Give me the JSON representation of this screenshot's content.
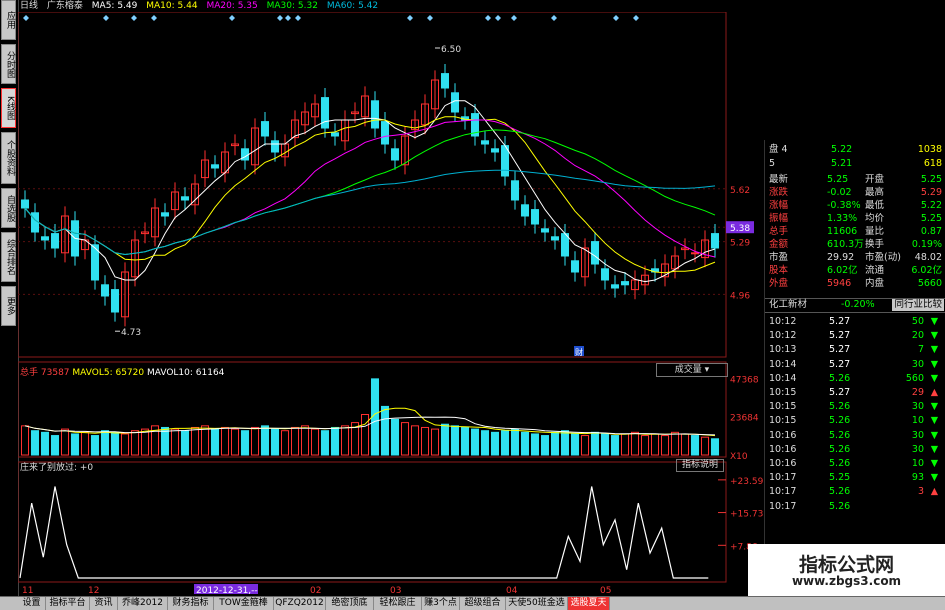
{
  "left_tabs": [
    "应用",
    "分时图",
    "K线图",
    "个股资料",
    "自选股",
    "综合排名",
    "更多"
  ],
  "header": {
    "period": "日线",
    "stock": "广东榕泰",
    "ma5": "MA5: 5.49",
    "ma10": "MA10: 5.44",
    "ma20": "MA20: 5.35",
    "ma30": "MA30: 5.32",
    "ma60": "MA60: 5.42"
  },
  "colors": {
    "ma5": "#ffffff",
    "ma10": "#ffff00",
    "ma20": "#ff00ff",
    "ma30": "#00ff00",
    "ma60": "#00b0d0",
    "up": "#ff3030",
    "down": "#30e0f0"
  },
  "price_chart": {
    "high_label": "6.50",
    "low_label": "4.73",
    "price_ticks": [
      "5.62",
      "5.38",
      "5.29",
      "4.96"
    ],
    "current_price": "5.38",
    "marker": "财"
  },
  "volume_panel": {
    "label": "总手",
    "total": "73587",
    "mavol5": "MAVOL5: 65720",
    "mavol10": "MAVOL10: 61164",
    "dropdown": "成交量",
    "ticks": [
      "47368",
      "23684",
      "X10"
    ]
  },
  "indicator_panel": {
    "title": "庄来了别放过: +0",
    "help": "指标说明",
    "ticks": [
      "+23.59",
      "+15.73",
      "+7.86"
    ]
  },
  "x_axis": {
    "labels": [
      "11",
      "12",
      "2012-12-31,--",
      "02",
      "03",
      "04",
      "05"
    ]
  },
  "quote": {
    "bids": [
      {
        "label": "盘 4",
        "price": "5.22",
        "vol": "1038"
      },
      {
        "label": "5",
        "price": "5.21",
        "vol": "618"
      }
    ],
    "rows": [
      {
        "l1": "最新",
        "v1": "5.25",
        "l2": "开盘",
        "v2": "5.25"
      },
      {
        "l1": "涨跌",
        "v1": "-0.02",
        "l2": "最高",
        "v2": "5.29"
      },
      {
        "l1": "涨幅",
        "v1": "-0.38%",
        "l2": "最低",
        "v2": "5.22"
      },
      {
        "l1": "振幅",
        "v1": "1.33%",
        "l2": "均价",
        "v2": "5.25"
      },
      {
        "l1": "总手",
        "v1": "11606",
        "l2": "量比",
        "v2": "0.87"
      },
      {
        "l1": "金额",
        "v1": "610.3万",
        "l2": "换手",
        "v2": "0.19%"
      },
      {
        "l1": "市盈",
        "v1": "29.92",
        "l2": "市盈(动)",
        "v2": "48.02"
      },
      {
        "l1": "股本",
        "v1": "6.02亿",
        "l2": "流通",
        "v2": "6.02亿"
      },
      {
        "l1": "外盘",
        "v1": "5946",
        "l2": "内盘",
        "v2": "5660"
      }
    ],
    "sector": "化工新材",
    "sector_change": "-0.20%",
    "compare_btn": "同行业比较",
    "ticks": [
      {
        "t": "10:12",
        "p": "5.27",
        "v": "50",
        "d": "down"
      },
      {
        "t": "10:12",
        "p": "5.27",
        "v": "20",
        "d": "down"
      },
      {
        "t": "10:13",
        "p": "5.27",
        "v": "7",
        "d": "down"
      },
      {
        "t": "10:14",
        "p": "5.27",
        "v": "30",
        "d": "down"
      },
      {
        "t": "10:14",
        "p": "5.26",
        "v": "560",
        "d": "down"
      },
      {
        "t": "10:15",
        "p": "5.27",
        "v": "29",
        "d": "up"
      },
      {
        "t": "10:15",
        "p": "5.26",
        "v": "30",
        "d": "down"
      },
      {
        "t": "10:15",
        "p": "5.26",
        "v": "10",
        "d": "down"
      },
      {
        "t": "10:16",
        "p": "5.26",
        "v": "30",
        "d": "down"
      },
      {
        "t": "10:16",
        "p": "5.26",
        "v": "30",
        "d": "down"
      },
      {
        "t": "10:16",
        "p": "5.26",
        "v": "10",
        "d": "down"
      },
      {
        "t": "10:17",
        "p": "5.25",
        "v": "93",
        "d": "down"
      },
      {
        "t": "10:17",
        "p": "5.26",
        "v": "3",
        "d": "up"
      },
      {
        "t": "10:17",
        "p": "5.26",
        "v": "",
        "d": ""
      }
    ]
  },
  "bottom_tabs": [
    "设置",
    "指标平台",
    "资讯",
    "乔峰2012",
    "财务指标",
    "TOW金箍棒",
    "QFZQ2012",
    "绝密顶底",
    "轻松跟庄",
    "赚3个点",
    "超级组合",
    "天使50班金选",
    "选股夏天"
  ],
  "watermark": {
    "title": "指标公式网",
    "url": "www.zbgs3.com"
  },
  "chart_data": {
    "type": "candlestick",
    "x_labels": [
      "11",
      "12",
      "2012-12-31,--",
      "02",
      "03",
      "04",
      "05"
    ],
    "price_range": [
      4.73,
      6.5
    ],
    "ylim": [
      4.6,
      6.6
    ],
    "close": [
      5.5,
      5.35,
      5.3,
      5.25,
      5.45,
      5.2,
      5.3,
      5.05,
      4.95,
      4.85,
      5.1,
      5.3,
      5.35,
      5.5,
      5.45,
      5.6,
      5.55,
      5.65,
      5.8,
      5.75,
      5.85,
      5.9,
      5.8,
      6.0,
      5.95,
      5.85,
      5.9,
      6.05,
      6.1,
      6.15,
      6.0,
      5.95,
      6.05,
      6.1,
      6.2,
      6.0,
      5.9,
      5.8,
      5.95,
      6.05,
      6.15,
      6.3,
      6.25,
      6.1,
      6.05,
      5.95,
      5.9,
      5.85,
      5.7,
      5.55,
      5.45,
      5.4,
      5.35,
      5.3,
      5.2,
      5.1,
      5.25,
      5.15,
      5.05,
      5.0,
      5.02,
      5.05,
      5.08,
      5.1,
      5.15,
      5.2,
      5.25,
      5.22,
      5.3,
      5.25
    ],
    "volume": [
      18,
      15,
      14,
      12,
      16,
      13,
      14,
      12,
      15,
      14,
      13,
      15,
      16,
      18,
      17,
      16,
      15,
      17,
      18,
      16,
      17,
      16,
      15,
      17,
      18,
      16,
      15,
      17,
      18,
      16,
      15,
      17,
      18,
      20,
      25,
      47,
      30,
      22,
      20,
      18,
      17,
      16,
      19,
      18,
      17,
      16,
      15,
      14,
      15,
      16,
      14,
      13,
      12,
      14,
      15,
      13,
      12,
      14,
      13,
      12,
      13,
      14,
      12,
      13,
      12,
      14,
      13,
      12,
      11,
      10
    ],
    "indicator": [
      0,
      18,
      5,
      22,
      8,
      0,
      0,
      0,
      0,
      0,
      0,
      0,
      0,
      0,
      0,
      0,
      0,
      0,
      0,
      0,
      0,
      0,
      0,
      0,
      0,
      0,
      0,
      0,
      0,
      0,
      0,
      0,
      0,
      0,
      0,
      0,
      0,
      0,
      0,
      0,
      0,
      0,
      0,
      0,
      0,
      0,
      0,
      10,
      4,
      22,
      8,
      14,
      2,
      18,
      6,
      12,
      0,
      0,
      0,
      0
    ]
  }
}
